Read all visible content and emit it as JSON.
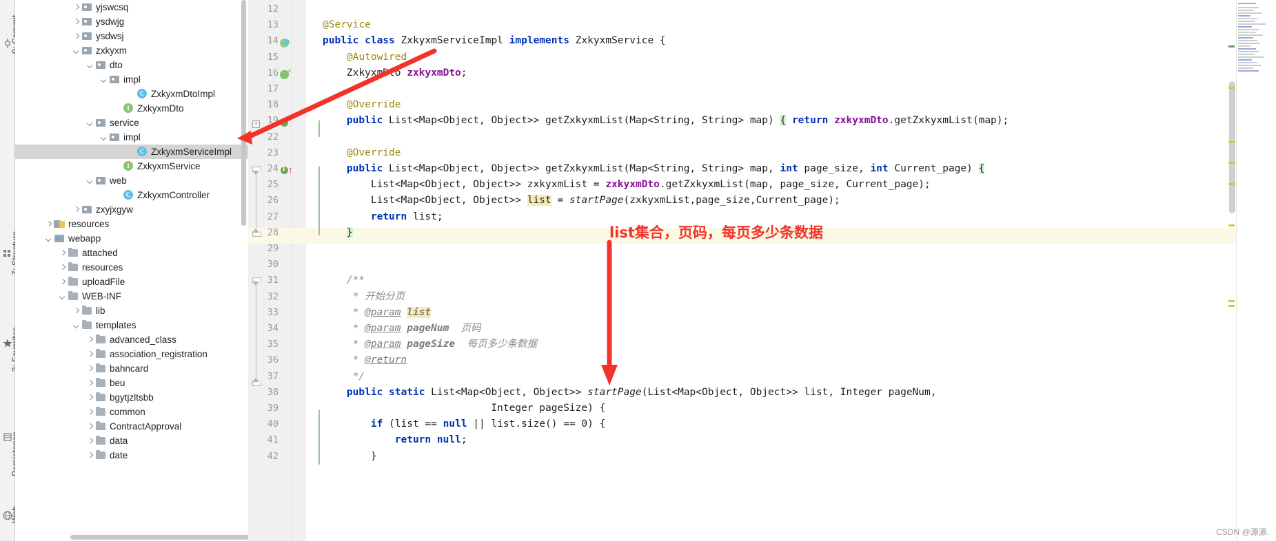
{
  "toolwindows": {
    "commit": "0: Commit",
    "structure": "7: Structure",
    "favorites": "2: Favorites",
    "persistence": "Persistence",
    "web": "Web"
  },
  "project_tree": {
    "items": [
      {
        "label": "yjswcsq",
        "indent": 4,
        "arrow": "right",
        "icon": "folder-icon",
        "selected": false
      },
      {
        "label": "ysdwjg",
        "indent": 4,
        "arrow": "right",
        "icon": "folder-icon",
        "selected": false
      },
      {
        "label": "ysdwsj",
        "indent": 4,
        "arrow": "right",
        "icon": "folder-icon",
        "selected": false
      },
      {
        "label": "zxkyxm",
        "indent": 4,
        "arrow": "down",
        "icon": "folder-icon",
        "selected": false
      },
      {
        "label": "dto",
        "indent": 5,
        "arrow": "down",
        "icon": "folder-icon",
        "selected": false
      },
      {
        "label": "impl",
        "indent": 6,
        "arrow": "down",
        "icon": "folder-icon",
        "selected": false
      },
      {
        "label": "ZxkyxmDtoImpl",
        "indent": 8,
        "arrow": "none",
        "icon": "class-icon",
        "selected": false
      },
      {
        "label": "ZxkyxmDto",
        "indent": 7,
        "arrow": "none",
        "icon": "interface-icon",
        "selected": false
      },
      {
        "label": "service",
        "indent": 5,
        "arrow": "down",
        "icon": "folder-icon",
        "selected": false
      },
      {
        "label": "impl",
        "indent": 6,
        "arrow": "down",
        "icon": "folder-icon",
        "selected": false
      },
      {
        "label": "ZxkyxmServiceImpl",
        "indent": 8,
        "arrow": "none",
        "icon": "class-icon",
        "selected": true
      },
      {
        "label": "ZxkyxmService",
        "indent": 7,
        "arrow": "none",
        "icon": "interface-icon",
        "selected": false
      },
      {
        "label": "web",
        "indent": 5,
        "arrow": "down",
        "icon": "folder-icon",
        "selected": false
      },
      {
        "label": "ZxkyxmController",
        "indent": 7,
        "arrow": "none",
        "icon": "class-icon",
        "selected": false
      },
      {
        "label": "zxyjxgyw",
        "indent": 4,
        "arrow": "right",
        "icon": "folder-icon",
        "selected": false
      },
      {
        "label": "resources",
        "indent": 2,
        "arrow": "right",
        "icon": "resource-folder-icon",
        "selected": false
      },
      {
        "label": "webapp",
        "indent": 2,
        "arrow": "down",
        "icon": "web-folder-icon",
        "selected": false
      },
      {
        "label": "attached",
        "indent": 3,
        "arrow": "right",
        "icon": "plain-folder-icon",
        "selected": false
      },
      {
        "label": "resources",
        "indent": 3,
        "arrow": "right",
        "icon": "plain-folder-icon",
        "selected": false
      },
      {
        "label": "uploadFile",
        "indent": 3,
        "arrow": "right",
        "icon": "plain-folder-icon",
        "selected": false
      },
      {
        "label": "WEB-INF",
        "indent": 3,
        "arrow": "down",
        "icon": "plain-folder-icon",
        "selected": false
      },
      {
        "label": "lib",
        "indent": 4,
        "arrow": "right",
        "icon": "plain-folder-icon",
        "selected": false
      },
      {
        "label": "templates",
        "indent": 4,
        "arrow": "down",
        "icon": "plain-folder-icon",
        "selected": false
      },
      {
        "label": "advanced_class",
        "indent": 5,
        "arrow": "right",
        "icon": "plain-folder-icon",
        "selected": false
      },
      {
        "label": "association_registration",
        "indent": 5,
        "arrow": "right",
        "icon": "plain-folder-icon",
        "selected": false
      },
      {
        "label": "bahncard",
        "indent": 5,
        "arrow": "right",
        "icon": "plain-folder-icon",
        "selected": false
      },
      {
        "label": "beu",
        "indent": 5,
        "arrow": "right",
        "icon": "plain-folder-icon",
        "selected": false
      },
      {
        "label": "bgytjzltsbb",
        "indent": 5,
        "arrow": "right",
        "icon": "plain-folder-icon",
        "selected": false
      },
      {
        "label": "common",
        "indent": 5,
        "arrow": "right",
        "icon": "plain-folder-icon",
        "selected": false
      },
      {
        "label": "ContractApproval",
        "indent": 5,
        "arrow": "right",
        "icon": "plain-folder-icon",
        "selected": false
      },
      {
        "label": "data",
        "indent": 5,
        "arrow": "right",
        "icon": "plain-folder-icon",
        "selected": false
      },
      {
        "label": "date",
        "indent": 5,
        "arrow": "right",
        "icon": "plain-folder-icon",
        "selected": false
      }
    ]
  },
  "editor": {
    "lines": [
      {
        "n": "12",
        "text": ""
      },
      {
        "n": "13",
        "text": "@Service"
      },
      {
        "n": "14",
        "text": "public class ZxkyxmServiceImpl implements ZxkyxmService {"
      },
      {
        "n": "15",
        "text": "    @Autowired"
      },
      {
        "n": "16",
        "text": "    ZxkyxmDto zxkyxmDto;"
      },
      {
        "n": "17",
        "text": ""
      },
      {
        "n": "18",
        "text": "    @Override"
      },
      {
        "n": "19",
        "text": "    public List<Map<Object, Object>> getZxkyxmList(Map<String, String> map) { return zxkyxmDto.getZxkyxmList(map);"
      },
      {
        "n": "22",
        "text": ""
      },
      {
        "n": "23",
        "text": "    @Override"
      },
      {
        "n": "24",
        "text": "    public List<Map<Object, Object>> getZxkyxmList(Map<String, String> map, int page_size, int Current_page) {"
      },
      {
        "n": "25",
        "text": "        List<Map<Object, Object>> zxkyxmList = zxkyxmDto.getZxkyxmList(map, page_size, Current_page);"
      },
      {
        "n": "26",
        "text": "        List<Map<Object, Object>> list = startPage(zxkyxmList,page_size,Current_page);"
      },
      {
        "n": "27",
        "text": "        return list;"
      },
      {
        "n": "28",
        "text": "    }"
      },
      {
        "n": "29",
        "text": ""
      },
      {
        "n": "30",
        "text": ""
      },
      {
        "n": "31",
        "text": "    /**"
      },
      {
        "n": "32",
        "text": "     * 开始分页"
      },
      {
        "n": "33",
        "text": "     * @param list"
      },
      {
        "n": "34",
        "text": "     * @param pageNum  页码"
      },
      {
        "n": "35",
        "text": "     * @param pageSize  每页多少条数据"
      },
      {
        "n": "36",
        "text": "     * @return"
      },
      {
        "n": "37",
        "text": "     */"
      },
      {
        "n": "38",
        "text": "    public static List<Map<Object, Object>> startPage(List<Map<Object, Object>> list, Integer pageNum,"
      },
      {
        "n": "39",
        "text": "                            Integer pageSize) {"
      },
      {
        "n": "40",
        "text": "        if (list == null || list.size() == 0) {"
      },
      {
        "n": "41",
        "text": "            return null;"
      },
      {
        "n": "42",
        "text": "        }"
      }
    ],
    "tokens": {
      "kw_public": "public",
      "kw_class": "class",
      "kw_implements": "implements",
      "kw_static": "static",
      "kw_return": "return",
      "kw_int": "int",
      "kw_if": "if",
      "kw_null": "null",
      "ann_service": "@Service",
      "ann_autowired": "@Autowired",
      "ann_override": "@Override",
      "ann_param": "@param",
      "ann_return": "@return",
      "type_ZxkyxmServiceImpl": "ZxkyxmServiceImpl",
      "type_ZxkyxmService": "ZxkyxmService",
      "type_ZxkyxmDto": "ZxkyxmDto",
      "field_zxkyxmDto": "zxkyxmDto",
      "method_getZxkyxmList": "getZxkyxmList",
      "method_startPage": "startPage",
      "var_list": "list",
      "var_zxkyxmList": "zxkyxmList",
      "var_map": "map",
      "var_page_size": "page_size",
      "var_Current_page": "Current_page",
      "var_pageNum": "pageNum",
      "var_pageSize": "pageSize",
      "type_List": "List",
      "type_Map": "Map",
      "type_Object": "Object",
      "type_String": "String",
      "type_Integer": "Integer",
      "cmt_kaishifenye": "开始分页",
      "cmt_yema": "页码",
      "cmt_meiye": "每页多少条数据"
    }
  },
  "annotations": {
    "note_text": "list集合，页码，每页多少条数据",
    "arrow_color": "#f2332a"
  },
  "watermark": "CSDN @源源."
}
